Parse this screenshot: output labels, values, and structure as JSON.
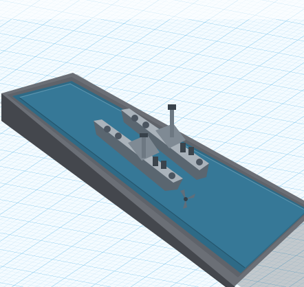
{
  "app": {
    "view": "3d-workplane",
    "background_color": "#ffffff",
    "grid_color_minor": "#bfe2f6",
    "grid_color_major": "#7cc6ec"
  },
  "scene": {
    "objects": [
      {
        "name": "display-case-base",
        "color": "#4b4e55"
      },
      {
        "name": "water-surface",
        "color": "#2e6a86"
      },
      {
        "name": "battleship-model-1",
        "color": "#9aa3ab"
      },
      {
        "name": "battleship-model-2",
        "color": "#9aa3ab"
      },
      {
        "name": "propeller",
        "color": "#4e5d6a"
      }
    ]
  }
}
